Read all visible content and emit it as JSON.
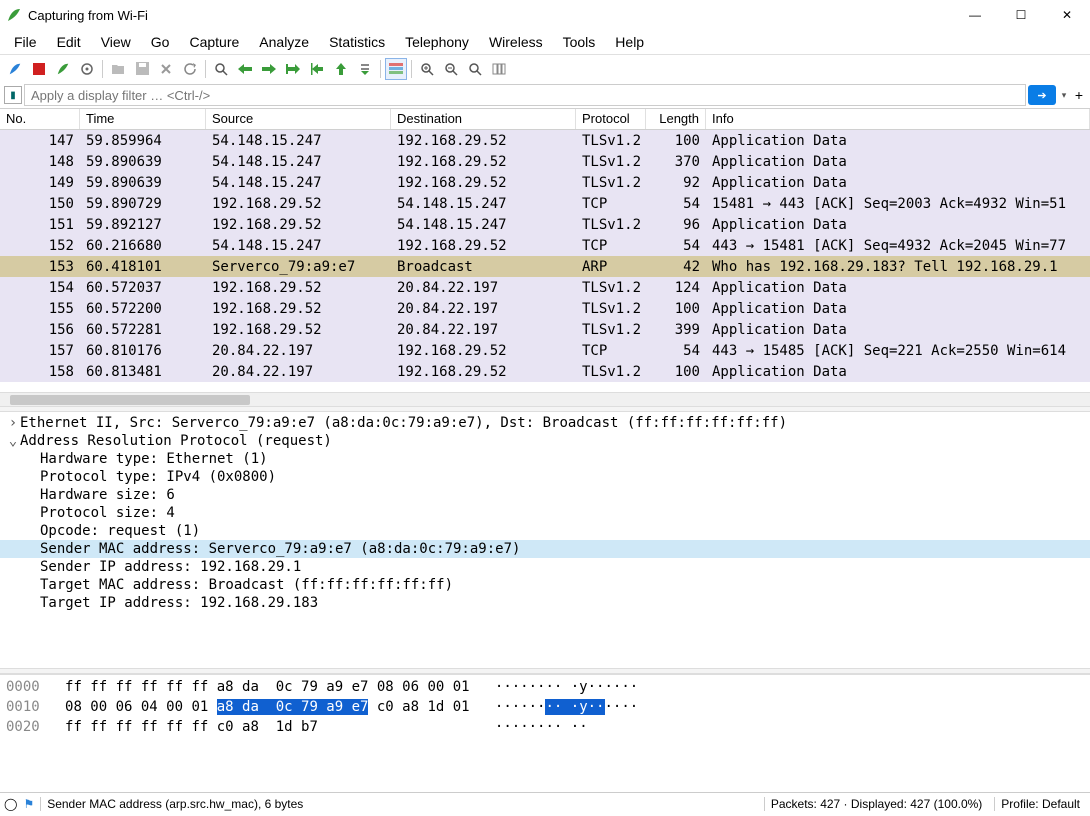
{
  "window": {
    "title": "Capturing from Wi-Fi",
    "min": "—",
    "max": "☐",
    "close": "✕"
  },
  "menu": [
    "File",
    "Edit",
    "View",
    "Go",
    "Capture",
    "Analyze",
    "Statistics",
    "Telephony",
    "Wireless",
    "Tools",
    "Help"
  ],
  "filter_placeholder": "Apply a display filter … <Ctrl-/>",
  "columns": {
    "no": "No.",
    "time": "Time",
    "src": "Source",
    "dst": "Destination",
    "proto": "Protocol",
    "len": "Length",
    "info": "Info"
  },
  "packets": [
    {
      "no": "147",
      "time": "59.859964",
      "src": "54.148.15.247",
      "dst": "192.168.29.52",
      "proto": "TLSv1.2",
      "len": "100",
      "info": "Application Data",
      "cls": "bg-tls"
    },
    {
      "no": "148",
      "time": "59.890639",
      "src": "54.148.15.247",
      "dst": "192.168.29.52",
      "proto": "TLSv1.2",
      "len": "370",
      "info": "Application Data",
      "cls": "bg-tls"
    },
    {
      "no": "149",
      "time": "59.890639",
      "src": "54.148.15.247",
      "dst": "192.168.29.52",
      "proto": "TLSv1.2",
      "len": "92",
      "info": "Application Data",
      "cls": "bg-tls"
    },
    {
      "no": "150",
      "time": "59.890729",
      "src": "192.168.29.52",
      "dst": "54.148.15.247",
      "proto": "TCP",
      "len": "54",
      "info": "15481 → 443 [ACK] Seq=2003 Ack=4932 Win=51",
      "cls": "bg-tcp"
    },
    {
      "no": "151",
      "time": "59.892127",
      "src": "192.168.29.52",
      "dst": "54.148.15.247",
      "proto": "TLSv1.2",
      "len": "96",
      "info": "Application Data",
      "cls": "bg-tls"
    },
    {
      "no": "152",
      "time": "60.216680",
      "src": "54.148.15.247",
      "dst": "192.168.29.52",
      "proto": "TCP",
      "len": "54",
      "info": "443 → 15481 [ACK] Seq=4932 Ack=2045 Win=77",
      "cls": "bg-tcp"
    },
    {
      "no": "153",
      "time": "60.418101",
      "src": "Serverco_79:a9:e7",
      "dst": "Broadcast",
      "proto": "ARP",
      "len": "42",
      "info": "Who has 192.168.29.183? Tell 192.168.29.1",
      "cls": "bg-arp-sel"
    },
    {
      "no": "154",
      "time": "60.572037",
      "src": "192.168.29.52",
      "dst": "20.84.22.197",
      "proto": "TLSv1.2",
      "len": "124",
      "info": "Application Data",
      "cls": "bg-tls"
    },
    {
      "no": "155",
      "time": "60.572200",
      "src": "192.168.29.52",
      "dst": "20.84.22.197",
      "proto": "TLSv1.2",
      "len": "100",
      "info": "Application Data",
      "cls": "bg-tls"
    },
    {
      "no": "156",
      "time": "60.572281",
      "src": "192.168.29.52",
      "dst": "20.84.22.197",
      "proto": "TLSv1.2",
      "len": "399",
      "info": "Application Data",
      "cls": "bg-tls"
    },
    {
      "no": "157",
      "time": "60.810176",
      "src": "20.84.22.197",
      "dst": "192.168.29.52",
      "proto": "TCP",
      "len": "54",
      "info": "443 → 15485 [ACK] Seq=221 Ack=2550 Win=614",
      "cls": "bg-tcp"
    },
    {
      "no": "158",
      "time": "60.813481",
      "src": "20.84.22.197",
      "dst": "192.168.29.52",
      "proto": "TLSv1.2",
      "len": "100",
      "info": "Application Data",
      "cls": "bg-tls"
    }
  ],
  "details": {
    "eth": "Ethernet II, Src: Serverco_79:a9:e7 (a8:da:0c:79:a9:e7), Dst: Broadcast (ff:ff:ff:ff:ff:ff)",
    "arp": "Address Resolution Protocol (request)",
    "hw_type": "Hardware type: Ethernet (1)",
    "proto_type": "Protocol type: IPv4 (0x0800)",
    "hw_size": "Hardware size: 6",
    "proto_size": "Protocol size: 4",
    "opcode": "Opcode: request (1)",
    "sender_mac": "Sender MAC address: Serverco_79:a9:e7 (a8:da:0c:79:a9:e7)",
    "sender_ip": "Sender IP address: 192.168.29.1",
    "target_mac": "Target MAC address: Broadcast (ff:ff:ff:ff:ff:ff)",
    "target_ip": "Target IP address: 192.168.29.183"
  },
  "hex": {
    "l0_off": "0000",
    "l0_a": "ff ff ff ff ff ff a8 da  0c 79 a9 e7 08 06 00 01",
    "l0_asc": "········ ·y······",
    "l1_off": "0010",
    "l1_a": "08 00 06 04 00 01 ",
    "l1_hl": "a8 da  0c 79 a9 e7",
    "l1_b": " c0 a8 1d 01",
    "l1_asc_a": "······",
    "l1_asc_hl": "·· ·y··",
    "l1_asc_b": "····",
    "l2_off": "0020",
    "l2_a": "ff ff ff ff ff ff c0 a8  1d b7",
    "l2_asc": "········ ··"
  },
  "status": {
    "field": "Sender MAC address (arp.src.hw_mac), 6 bytes",
    "packets": "Packets: 427 · Displayed: 427 (100.0%)",
    "profile": "Profile: Default"
  },
  "icons": {
    "shark": "shark-fin-icon",
    "stop": "stop-icon",
    "restart": "restart-icon",
    "options": "options-icon",
    "open": "open-icon",
    "save": "save-icon",
    "close": "close-icon",
    "reload": "reload-icon",
    "find": "find-icon",
    "back": "back-icon",
    "fwd": "fwd-icon",
    "goto": "goto-icon",
    "first": "first-icon",
    "last": "last-icon",
    "autoscroll": "autoscroll-icon",
    "colorize": "colorize-icon",
    "zoomin": "zoomin-icon",
    "zoomout": "zoomout-icon",
    "zoom100": "zoom100-icon",
    "resize": "resize-cols-icon"
  }
}
